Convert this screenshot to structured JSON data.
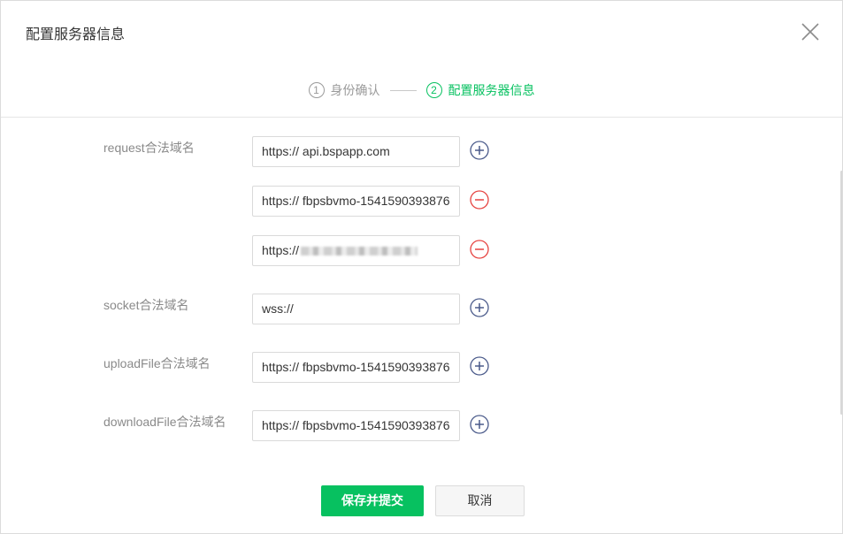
{
  "dialog": {
    "title": "配置服务器信息"
  },
  "steps": [
    {
      "num": "1",
      "label": "身份确认"
    },
    {
      "num": "2",
      "label": "配置服务器信息"
    }
  ],
  "fields": {
    "request": {
      "label": "request合法域名",
      "values": [
        "https:// api.bspapp.com",
        "https:// fbpsbvmo-1541590393876",
        "https://"
      ]
    },
    "socket": {
      "label": "socket合法域名",
      "value": "wss://"
    },
    "uploadFile": {
      "label": "uploadFile合法域名",
      "value": "https:// fbpsbvmo-1541590393876"
    },
    "downloadFile": {
      "label": "downloadFile合法域名",
      "value": "https:// fbpsbvmo-1541590393876"
    }
  },
  "buttons": {
    "submit": "保存并提交",
    "cancel": "取消"
  },
  "icons": {
    "close": "close-icon",
    "add": "plus-circle-icon",
    "remove": "minus-circle-icon"
  },
  "colors": {
    "accent": "#07c160",
    "add": "#4a5a8a",
    "remove": "#e64340"
  }
}
